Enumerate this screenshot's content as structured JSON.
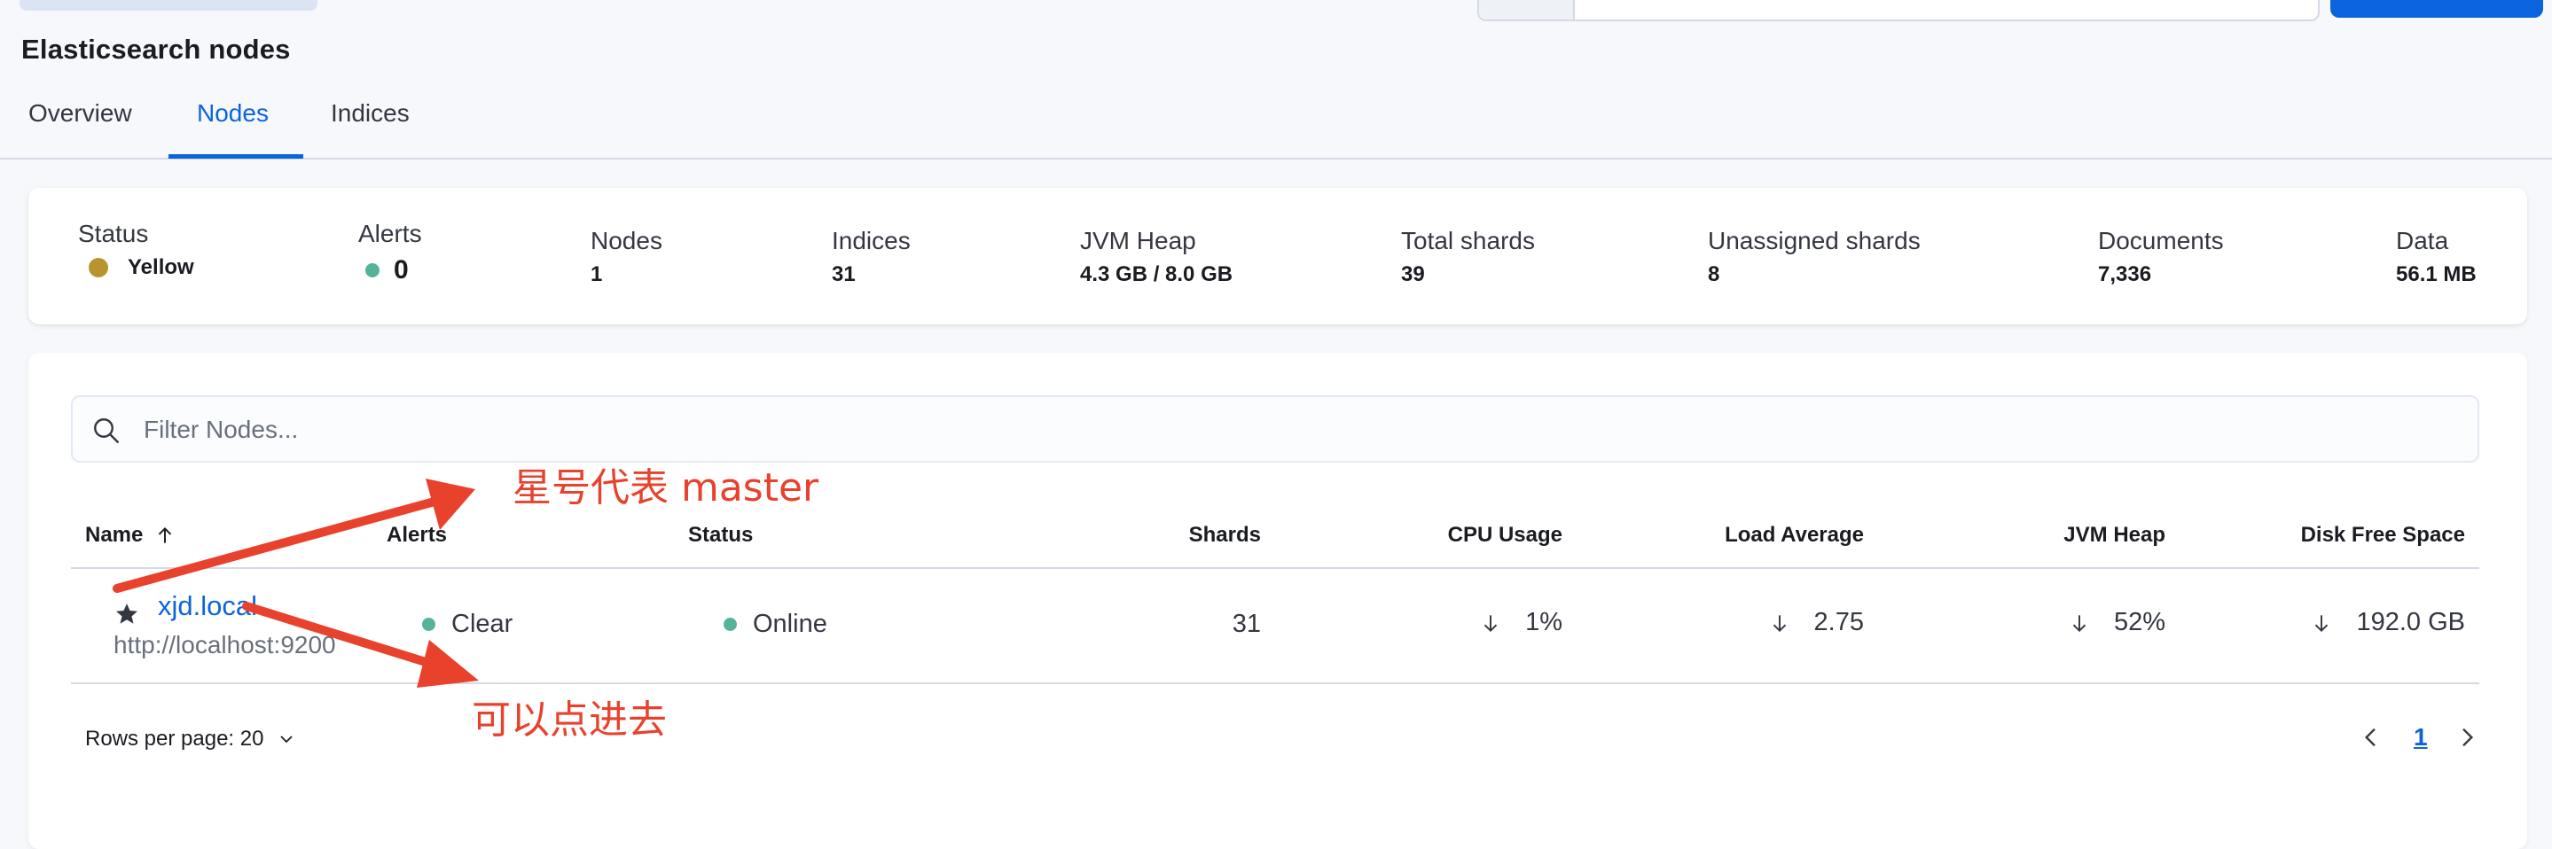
{
  "page": {
    "title": "Elasticsearch nodes"
  },
  "tabs": [
    {
      "label": "Overview",
      "active": false
    },
    {
      "label": "Nodes",
      "active": true
    },
    {
      "label": "Indices",
      "active": false
    }
  ],
  "summary": {
    "status": {
      "label": "Status",
      "value": "Yellow",
      "color": "#b8932e"
    },
    "alerts": {
      "label": "Alerts",
      "value": "0",
      "color": "#54b399"
    },
    "nodes": {
      "label": "Nodes",
      "value": "1"
    },
    "indices": {
      "label": "Indices",
      "value": "31"
    },
    "jvm_heap": {
      "label": "JVM Heap",
      "value": "4.3 GB / 8.0 GB"
    },
    "total_shards": {
      "label": "Total shards",
      "value": "39"
    },
    "unassigned_shards": {
      "label": "Unassigned shards",
      "value": "8"
    },
    "documents": {
      "label": "Documents",
      "value": "7,336"
    },
    "data": {
      "label": "Data",
      "value": "56.1 MB"
    }
  },
  "filter": {
    "placeholder": "Filter Nodes..."
  },
  "table": {
    "columns": {
      "name": "Name",
      "alerts": "Alerts",
      "status": "Status",
      "shards": "Shards",
      "cpu": "CPU Usage",
      "load": "Load Average",
      "jvm": "JVM Heap",
      "disk": "Disk Free Space"
    },
    "rows": [
      {
        "name": "xjd.local",
        "url": "http://localhost:9200",
        "alerts": "Clear",
        "status": "Online",
        "shards": "31",
        "cpu": "1%",
        "load": "2.75",
        "jvm": "52%",
        "disk": "192.0 GB"
      }
    ]
  },
  "pagination": {
    "rows_per_page": "Rows per page: 20",
    "current_page": "1"
  },
  "annotations": {
    "master_note": "星号代表 master",
    "click_note": "可以点进去"
  },
  "colors": {
    "accent": "#0b64dd",
    "annotation": "#e8412c",
    "online": "#54b399",
    "warning": "#b8932e"
  }
}
